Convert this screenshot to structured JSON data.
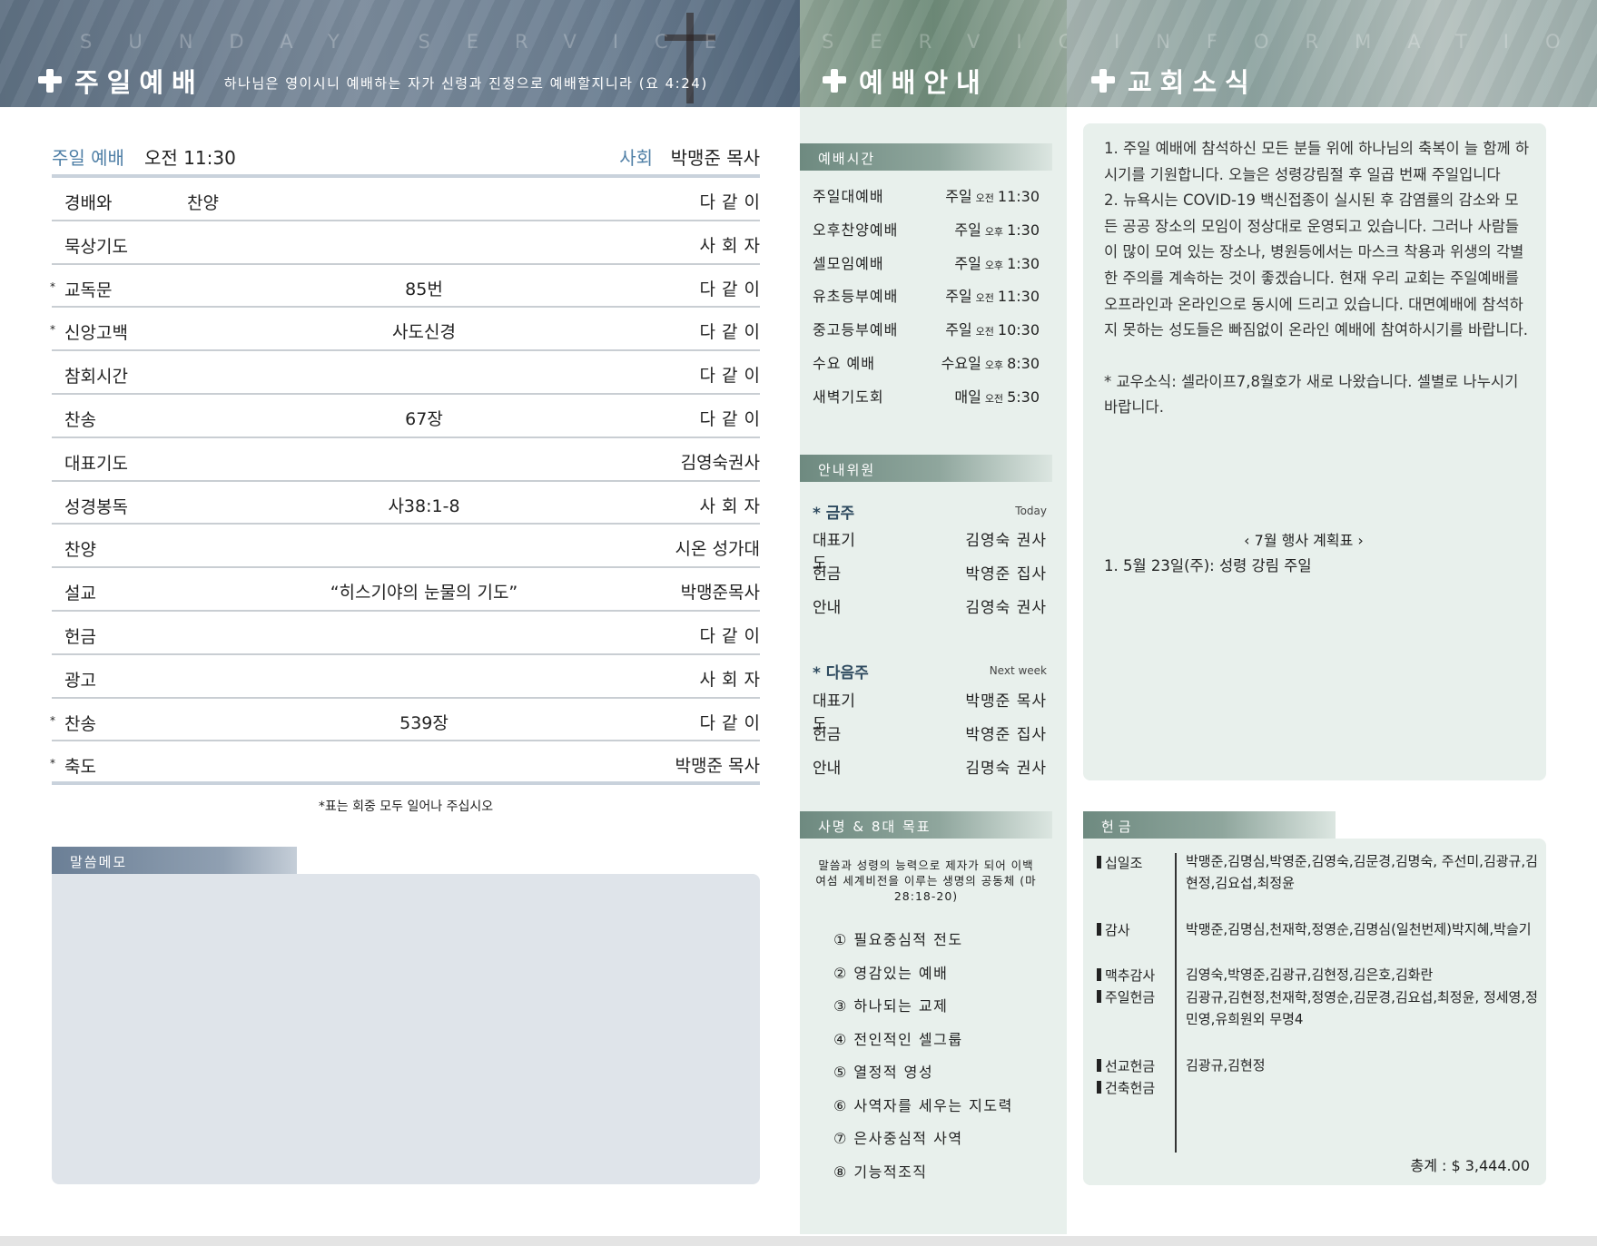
{
  "header": {
    "left_word": "SUNDAY SERVICE",
    "left_title": "주일예배",
    "left_verse": "하나님은 영이시니 예배하는 자가 신령과 진정으로 예배할지니라 (요 4:24)",
    "mid_word": "SERVICE",
    "mid_title": "예배안내",
    "right_word": "INFORMATION",
    "right_title": "교회소식"
  },
  "service": {
    "label": "주일 예배",
    "time": "오전 11:30",
    "leader_label": "사회",
    "leader": "박맹준 목사",
    "rows": [
      {
        "star": "",
        "item": "경배와 찬양",
        "mid": "",
        "who": "다같이"
      },
      {
        "star": "",
        "item": "묵상기도",
        "mid": "",
        "who": "사회자"
      },
      {
        "star": "*",
        "item": "교독문",
        "mid": "85번",
        "who": "다같이"
      },
      {
        "star": "*",
        "item": "신앙고백",
        "mid": "사도신경",
        "who": "다같이"
      },
      {
        "star": "",
        "item": "참회시간",
        "mid": "",
        "who": "다같이"
      },
      {
        "star": "",
        "item": "찬송",
        "mid": "67장",
        "who": "다같이"
      },
      {
        "star": "",
        "item": "대표기도",
        "mid": "",
        "who": "김영숙권사"
      },
      {
        "star": "",
        "item": "성경봉독",
        "mid": "사38:1-8",
        "who": "사회자"
      },
      {
        "star": "",
        "item": "찬양",
        "mid": "",
        "who": "시온 성가대"
      },
      {
        "star": "",
        "item": "설교",
        "mid": "“히스기야의 눈물의 기도”",
        "who": "박맹준목사"
      },
      {
        "star": "",
        "item": "헌금",
        "mid": "",
        "who": "다같이"
      },
      {
        "star": "",
        "item": "광고",
        "mid": "",
        "who": "사회자"
      },
      {
        "star": "*",
        "item": "찬송",
        "mid": "539장",
        "who": "다같이"
      },
      {
        "star": "*",
        "item": "축도",
        "mid": "",
        "who": "박맹준 목사"
      }
    ],
    "note": "*표는 회중 모두 일어나 주십시오",
    "memo_label": "말씀메모"
  },
  "guide": {
    "times_label": "예배시간",
    "times": [
      {
        "name": "주일대예배",
        "day": "주일",
        "ampm": "오전",
        "time": "11:30"
      },
      {
        "name": "오후찬양예배",
        "day": "주일",
        "ampm": "오후",
        "time": "1:30"
      },
      {
        "name": "셀모임예배",
        "day": "주일",
        "ampm": "오후",
        "time": "1:30"
      },
      {
        "name": "유초등부예배",
        "day": "주일",
        "ampm": "오전",
        "time": "11:30"
      },
      {
        "name": "중고등부예배",
        "day": "주일",
        "ampm": "오전",
        "time": "10:30"
      },
      {
        "name": "수요 예배",
        "day": "수요일",
        "ampm": "오후",
        "time": "8:30"
      },
      {
        "name": "새벽기도회",
        "day": "매일",
        "ampm": "오전",
        "time": "5:30"
      }
    ],
    "duty_label": "안내위원",
    "this_week": {
      "label": "* 금주",
      "en": "Today"
    },
    "this_week_rows": [
      {
        "role": "대표기도",
        "person": "김영숙 권사"
      },
      {
        "role": "헌금",
        "person": "박영준 집사"
      },
      {
        "role": "안내",
        "person": "김영숙 권사"
      }
    ],
    "next_week": {
      "label": "* 다음주",
      "en": "Next week"
    },
    "next_week_rows": [
      {
        "role": "대표기도",
        "person": "박맹준 목사"
      },
      {
        "role": "헌금",
        "person": "박영준 집사"
      },
      {
        "role": "안내",
        "person": "김명숙 권사"
      }
    ],
    "mission_label": "사명 & 8대 목표",
    "mission_text": "말씀과 성령의 능력으로 제자가 되어 이백 여섬 세계비전을 이루는 생명의 공동체 (마 28:18-20)",
    "goals": [
      "① 필요중심적 전도",
      "② 영감있는 예배",
      "③ 하나되는 교제",
      "④ 전인적인 셀그룹",
      "⑤ 열정적 영성",
      "⑥ 사역자를 세우는 지도력",
      "⑦ 은사중심적 사역",
      "⑧ 기능적조직"
    ]
  },
  "news": {
    "paragraphs": [
      "1. 주일 예배에 참석하신 모든 분들 위에 하나님의 축복이 늘 함께 하시기를 기원합니다. 오늘은 성령강림절 후 일곱 번째 주일입니다",
      "2. 뉴욕시는 COVID-19 백신접종이 실시된 후 감염률의 감소와 모든 공공 장소의 모임이 정상대로 운영되고 있습니다. 그러나 사람들이 많이 모여 있는 장소나, 병원등에서는 마스크 착용과 위생의 각별한 주의를 계속하는 것이 좋겠습니다. 현재 우리 교회는 주일예배를 오프라인과 온라인으로 동시에 드리고 있습니다. 대면예배에 참석하지 못하는 성도들은 빠짐없이 온라인 예배에 참여하시기를 바랍니다.",
      "* 교우소식: 셀라이프7,8월호가 새로 나왔습니다. 셀별로 나누시기 바랍니다."
    ],
    "calendar_title": "‹  7월 행사 계획표  ›",
    "calendar_item": "1. 5월 23일(주): 성령 강림 주일"
  },
  "offering": {
    "label": "헌금",
    "groups": [
      {
        "cat": "십일조",
        "names": "박맹준,김명심,박영준,김영숙,김문경,김명숙, 주선미,김광규,김현정,김요섭,최정윤"
      },
      {
        "cat": "감사",
        "names": "박맹준,김명심,천재학,정영순,김명심(일천번제)박지혜,박슬기"
      },
      {
        "cat": "맥추감사",
        "names": "김영숙,박영준,김광규,김현정,김은호,김화란"
      },
      {
        "cat": "주일헌금",
        "names": "김광규,김현정,천재학,정영순,김문경,김요섭,최정윤, 정세영,정민영,유희원외 무명4"
      },
      {
        "cat": "선교헌금",
        "names": "김광규,김현정"
      },
      {
        "cat": "건축헌금",
        "names": ""
      }
    ],
    "total": "총계 : $ 3,444.00"
  }
}
